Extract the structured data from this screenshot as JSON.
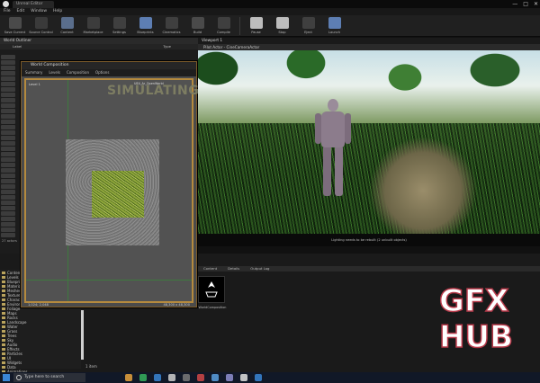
{
  "window": {
    "tab_label": "Unreal Editor",
    "minimize": "—",
    "maximize": "□",
    "close": "✕"
  },
  "menu": [
    "File",
    "Edit",
    "Window",
    "Help"
  ],
  "toolbar": [
    {
      "label": "Save Current",
      "color": "#4a4a4a"
    },
    {
      "label": "Source Control",
      "color": "#3a3a3a"
    },
    {
      "label": "Content",
      "color": "#5a6e8c"
    },
    {
      "label": "Marketplace",
      "color": "#3c3c3c"
    },
    {
      "label": "Settings",
      "color": "#3f3f3f"
    },
    {
      "label": "Blueprints",
      "color": "#5d7eb3"
    },
    {
      "label": "Cinematics",
      "color": "#3f3f3f"
    },
    {
      "label": "Build",
      "color": "#4a4a4a"
    },
    {
      "label": "Compile",
      "color": "#3f3f3f"
    },
    {
      "label": "Pause",
      "color": "#bdbdbd"
    },
    {
      "label": "Stop",
      "color": "#bdbdbd"
    },
    {
      "label": "Eject",
      "color": "#3f3f3f"
    },
    {
      "label": "Launch",
      "color": "#5d7eb3"
    }
  ],
  "outliner": {
    "title": "World Outliner",
    "header_label": "Label",
    "header_type": "Type",
    "actors_count": "27 actors"
  },
  "world_composition": {
    "title": "World Composition",
    "menu": [
      "Summary",
      "Levels",
      "Composition",
      "Options"
    ],
    "overlay_text": "SIMULATING",
    "level_label": "Level 1",
    "coord_left": "1,024; 2,048",
    "coord_right": "48,300 x 48,300",
    "level_name": "UE4_Ar_OpenWorld"
  },
  "viewport": {
    "tab_label": "Viewport 1",
    "header": "Pilot Actor - CineCameraActor",
    "status_text": "Lighting needs to be rebuilt (2 unbuilt objects)"
  },
  "content_browser": {
    "tabs": [
      "Content",
      "Details",
      "Output Log"
    ],
    "folders": [
      "Content",
      "Levels",
      "Blueprints",
      "Materials",
      "Meshes",
      "Textures",
      "Characters",
      "Environment",
      "Foliage",
      "Maps",
      "Rocks",
      "Landscape",
      "Water",
      "Grass",
      "Trees",
      "Sky",
      "Audio",
      "Effects",
      "Particles",
      "UI",
      "Widgets",
      "Data",
      "Animations"
    ],
    "asset_label": "WorldComposition",
    "items_count": "1 item"
  },
  "taskbar": {
    "search_placeholder": "Type here to search",
    "icon_colors": [
      "#e8a33d",
      "#36b25e",
      "#3a86d6",
      "#cfcfcf",
      "#7a7a7a",
      "#d04848",
      "#5aa0e0",
      "#8f8fd0",
      "#e0e0e0",
      "#3a86d6"
    ]
  },
  "watermark": {
    "line1": "GFX",
    "line2": "HUB"
  }
}
